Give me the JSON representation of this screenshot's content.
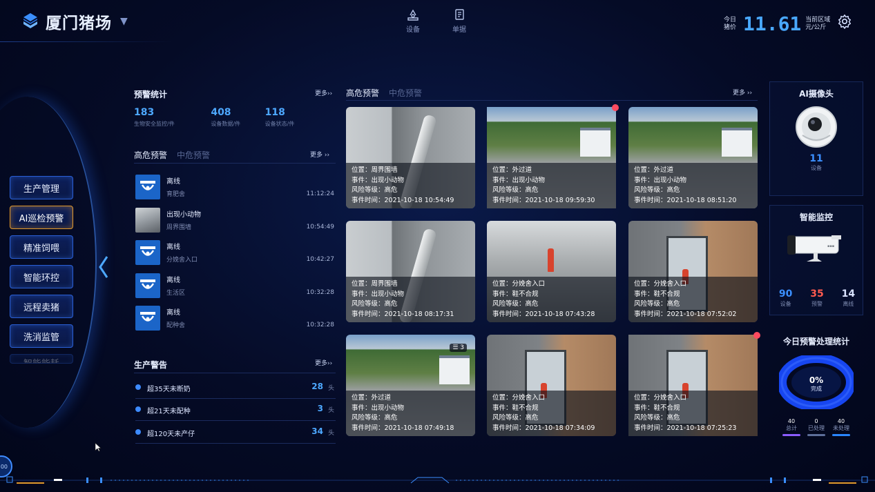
{
  "header": {
    "title": "厦门猪场",
    "nav": [
      {
        "label": "设备",
        "icon": "device-icon"
      },
      {
        "label": "单据",
        "icon": "document-icon"
      }
    ],
    "price_label": "今日猪价",
    "price_value": "11.61",
    "price_unit": "当前区域元/公斤"
  },
  "sidebar": {
    "items": [
      {
        "label": "生产管理",
        "active": false
      },
      {
        "label": "AI巡检预警",
        "active": true
      },
      {
        "label": "精准饲喂",
        "active": false
      },
      {
        "label": "智能环控",
        "active": false
      },
      {
        "label": "远程卖猪",
        "active": false
      },
      {
        "label": "洗消监管",
        "active": false
      },
      {
        "label": "智能能耗",
        "active": false
      }
    ],
    "corner_badge": "00"
  },
  "warning_stats": {
    "title": "预警统计",
    "more": "更多››",
    "stats": [
      {
        "value": "183",
        "label": "生物安全监控/件"
      },
      {
        "value": "408",
        "label": "设备数据/件"
      },
      {
        "value": "118",
        "label": "设备状态/件"
      }
    ]
  },
  "alert_list": {
    "tabs": [
      "高危预警",
      "中危预警"
    ],
    "more": "更多 ››",
    "items": [
      {
        "title": "离线",
        "location": "育肥舍",
        "time": "11:12:24",
        "thumb": "camera"
      },
      {
        "title": "出现小动物",
        "location": "周界围墙",
        "time": "10:54:49",
        "thumb": "photo"
      },
      {
        "title": "离线",
        "location": "分娩舍入口",
        "time": "10:42:27",
        "thumb": "camera"
      },
      {
        "title": "离线",
        "location": "生活区",
        "time": "10:32:28",
        "thumb": "camera"
      },
      {
        "title": "离线",
        "location": "配种舍",
        "time": "10:32:28",
        "thumb": "camera"
      }
    ]
  },
  "production": {
    "title": "生产警告",
    "more": "更多››",
    "items": [
      {
        "label": "超35天未断奶",
        "count": "28",
        "unit": "头"
      },
      {
        "label": "超21天未配种",
        "count": "3",
        "unit": "头"
      },
      {
        "label": "超120天未产仔",
        "count": "34",
        "unit": "头"
      }
    ]
  },
  "center": {
    "tabs": [
      "高危预警",
      "中危预警"
    ],
    "more": "更多 ››",
    "field_labels": {
      "location": "位置：",
      "event": "事件：",
      "risk": "风险等级：",
      "time": "事件时间："
    },
    "cards": [
      {
        "location": "周界围墙",
        "event": "出现小动物",
        "risk": "高危",
        "time": "2021-10-18 10:54:49",
        "scene": "wall",
        "red_dot": false,
        "stack": ""
      },
      {
        "location": "外过道",
        "event": "出现小动物",
        "risk": "高危",
        "time": "2021-10-18 09:59:30",
        "scene": "road",
        "red_dot": true,
        "stack": ""
      },
      {
        "location": "外过道",
        "event": "出现小动物",
        "risk": "高危",
        "time": "2021-10-18 08:51:20",
        "scene": "road",
        "red_dot": false,
        "stack": ""
      },
      {
        "location": "周界围墙",
        "event": "出现小动物",
        "risk": "高危",
        "time": "2021-10-18 08:17:31",
        "scene": "wall",
        "red_dot": false,
        "stack": ""
      },
      {
        "location": "分娩舍入口",
        "event": "鞋不合规",
        "risk": "高危",
        "time": "2021-10-18 07:43:28",
        "scene": "barn",
        "red_dot": false,
        "stack": ""
      },
      {
        "location": "分娩舍入口",
        "event": "鞋不合规",
        "risk": "高危",
        "time": "2021-10-18 07:52:02",
        "scene": "room",
        "red_dot": false,
        "stack": ""
      },
      {
        "location": "外过道",
        "event": "出现小动物",
        "risk": "高危",
        "time": "2021-10-18 07:49:18",
        "scene": "road",
        "red_dot": false,
        "stack": "3"
      },
      {
        "location": "分娩舍入口",
        "event": "鞋不合规",
        "risk": "高危",
        "time": "2021-10-18 07:34:09",
        "scene": "room",
        "red_dot": false,
        "stack": ""
      },
      {
        "location": "分娩舍入口",
        "event": "鞋不合规",
        "risk": "高危",
        "time": "2021-10-18 07:25:23",
        "scene": "room",
        "red_dot": true,
        "stack": ""
      }
    ]
  },
  "ai_camera": {
    "title": "AI摄像头",
    "count": "11",
    "count_label": "设备"
  },
  "smart_monitor": {
    "title": "智能监控",
    "stats": [
      {
        "value": "90",
        "label": "设备",
        "color": "#3b8fff"
      },
      {
        "value": "35",
        "label": "预警",
        "color": "#ff5a4f"
      },
      {
        "value": "14",
        "label": "离线",
        "color": "#d9e2ff"
      }
    ]
  },
  "today_stats": {
    "title": "今日预警处理统计",
    "percent": "0%",
    "percent_label": "完成",
    "completion": 0,
    "items": [
      {
        "value": "40",
        "label": "总计",
        "color": "#8b5cff"
      },
      {
        "value": "0",
        "label": "已处理",
        "color": "#5d6f9a"
      },
      {
        "value": "40",
        "label": "未处理",
        "color": "#2a86ff"
      }
    ]
  },
  "colors": {
    "accent": "#4da8ff",
    "danger": "#ff4a5f",
    "active_border": "#e39a2c"
  }
}
